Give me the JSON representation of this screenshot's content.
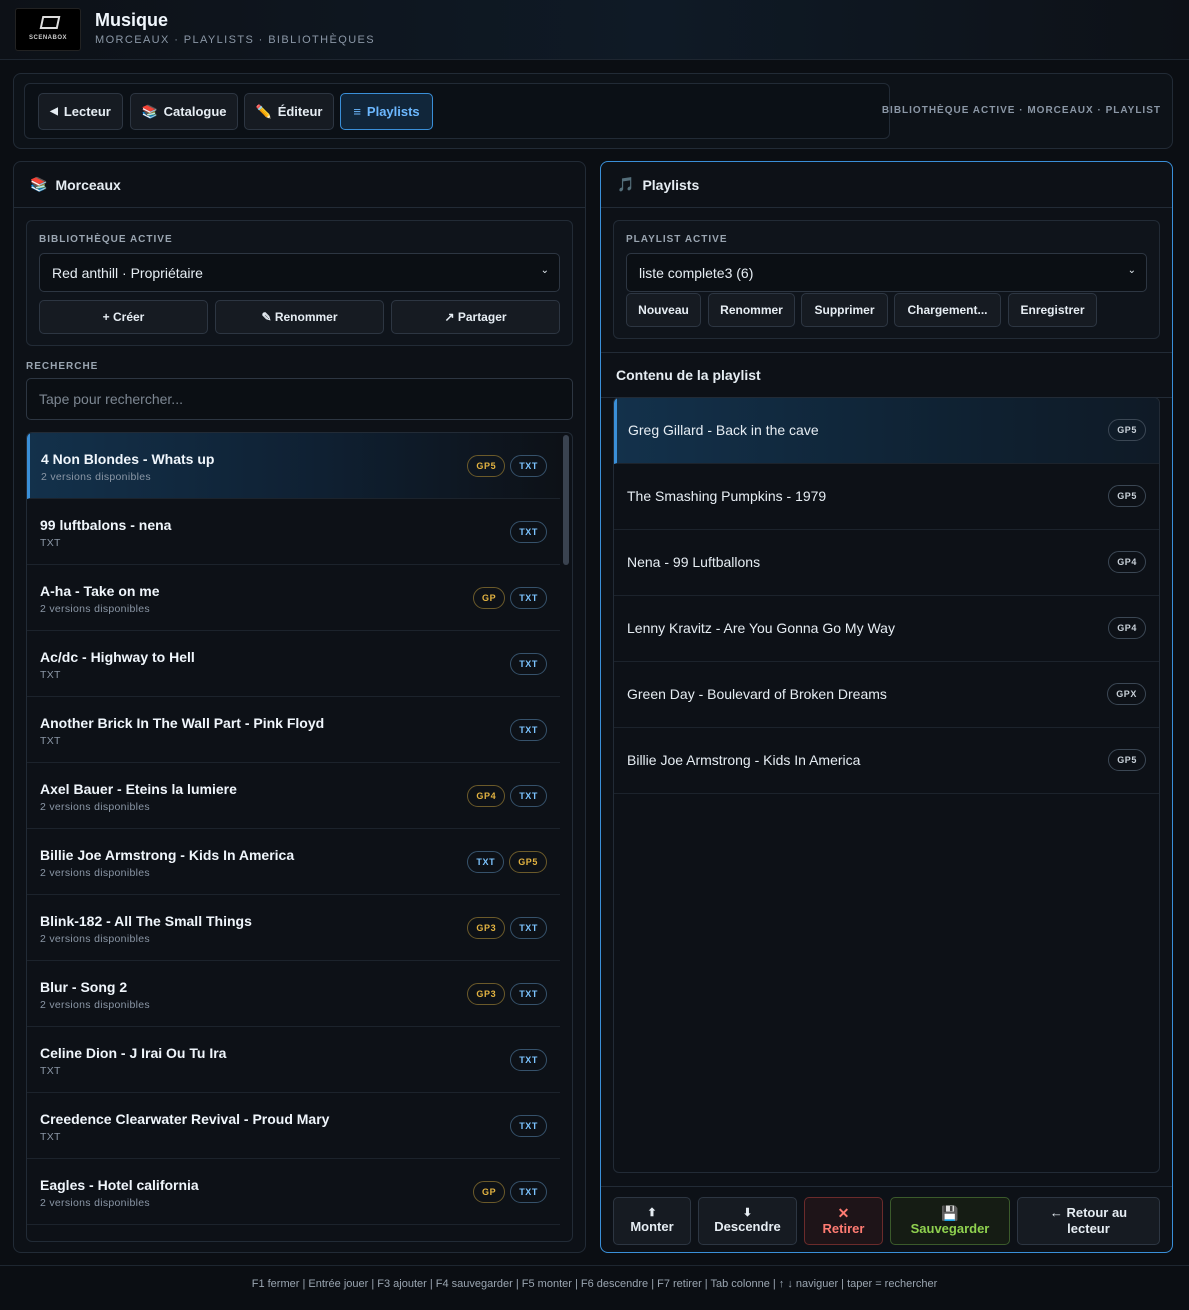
{
  "header": {
    "title": "Musique",
    "subtitle": "MORCEAUX · PLAYLISTS · BIBLIOTHÈQUES",
    "logo_text": "SCENABOX"
  },
  "nav": {
    "tabs": [
      {
        "icon": "◀",
        "label": "Lecteur"
      },
      {
        "icon": "📚",
        "label": "Catalogue"
      },
      {
        "icon": "✏️",
        "label": "Éditeur"
      },
      {
        "icon": "≡",
        "label": "Playlists"
      }
    ],
    "active_tab": "Playlists",
    "breadcrumb": "BIBLIOTHÈQUE ACTIVE · MORCEAUX · PLAYLIST"
  },
  "left": {
    "title_icon": "📚",
    "title": "Morceaux",
    "library_label": "BIBLIOTHÈQUE ACTIVE",
    "library_value": "Red anthill · Propriétaire",
    "buttons": {
      "create": "+ Créer",
      "rename": "✎ Renommer",
      "share": "↗ Partager"
    },
    "search_label": "RECHERCHE",
    "search_placeholder": "Tape pour rechercher...",
    "songs": [
      {
        "title": "4 Non Blondes - Whats up",
        "sub": "2 versions disponibles",
        "badges": [
          "GP5",
          "TXT"
        ]
      },
      {
        "title": "99 luftbalons - nena",
        "sub": "TXT",
        "badges": [
          "TXT"
        ]
      },
      {
        "title": "A-ha - Take on me",
        "sub": "2 versions disponibles",
        "badges": [
          "GP",
          "TXT"
        ]
      },
      {
        "title": "Ac/dc - Highway to Hell",
        "sub": "TXT",
        "badges": [
          "TXT"
        ]
      },
      {
        "title": "Another Brick In The Wall Part - Pink Floyd",
        "sub": "TXT",
        "badges": [
          "TXT"
        ]
      },
      {
        "title": "Axel Bauer - Eteins la lumiere",
        "sub": "2 versions disponibles",
        "badges": [
          "GP4",
          "TXT"
        ]
      },
      {
        "title": "Billie Joe Armstrong - Kids In America",
        "sub": "2 versions disponibles",
        "badges": [
          "TXT",
          "GP5"
        ]
      },
      {
        "title": "Blink-182 - All The Small Things",
        "sub": "2 versions disponibles",
        "badges": [
          "GP3",
          "TXT"
        ]
      },
      {
        "title": "Blur - Song 2",
        "sub": "2 versions disponibles",
        "badges": [
          "GP3",
          "TXT"
        ]
      },
      {
        "title": "Celine Dion - J Irai Ou Tu Ira",
        "sub": "TXT",
        "badges": [
          "TXT"
        ]
      },
      {
        "title": "Creedence Clearwater Revival - Proud Mary",
        "sub": "TXT",
        "badges": [
          "TXT"
        ]
      },
      {
        "title": "Eagles - Hotel california",
        "sub": "2 versions disponibles",
        "badges": [
          "GP",
          "TXT"
        ]
      }
    ]
  },
  "right": {
    "title_icon": "🎵",
    "title": "Playlists",
    "playlist_label": "PLAYLIST ACTIVE",
    "playlist_value": "liste complete3 (6)",
    "buttons": {
      "new": "Nouveau",
      "rename": "Renommer",
      "delete": "Supprimer",
      "load": "Chargement...",
      "save": "Enregistrer"
    },
    "content_title": "Contenu de la playlist",
    "items": [
      {
        "title": "Greg Gillard - Back in the cave",
        "badge": "GP5"
      },
      {
        "title": "The Smashing Pumpkins - 1979",
        "badge": "GP5"
      },
      {
        "title": "Nena - 99 Luftballons",
        "badge": "GP4"
      },
      {
        "title": "Lenny Kravitz - Are You Gonna Go My Way",
        "badge": "GP4"
      },
      {
        "title": "Green Day - Boulevard of Broken Dreams",
        "badge": "GPX"
      },
      {
        "title": "Billie Joe Armstrong - Kids In America",
        "badge": "GP5"
      }
    ],
    "actions": {
      "up_icon": "⬆",
      "up": "Monter",
      "down_icon": "⬇",
      "down": "Descendre",
      "remove_icon": "✕",
      "remove": "Retirer",
      "save_icon": "💾",
      "save": "Sauvegarder",
      "back_line1": "← Retour au",
      "back_line2": "lecteur"
    }
  },
  "footer": "F1 fermer | Entrée jouer | F3 ajouter | F4 sauvegarder | F5 monter | F6 descendre | F7 retirer | Tab colonne | ↑ ↓ naviguer | taper = rechercher",
  "colors": {
    "accent": "#3a8fd8",
    "txt_badge": "#7cc4ff",
    "gp_badge": "#e3b341",
    "danger": "#ff7b72",
    "success": "#8fd14f"
  }
}
